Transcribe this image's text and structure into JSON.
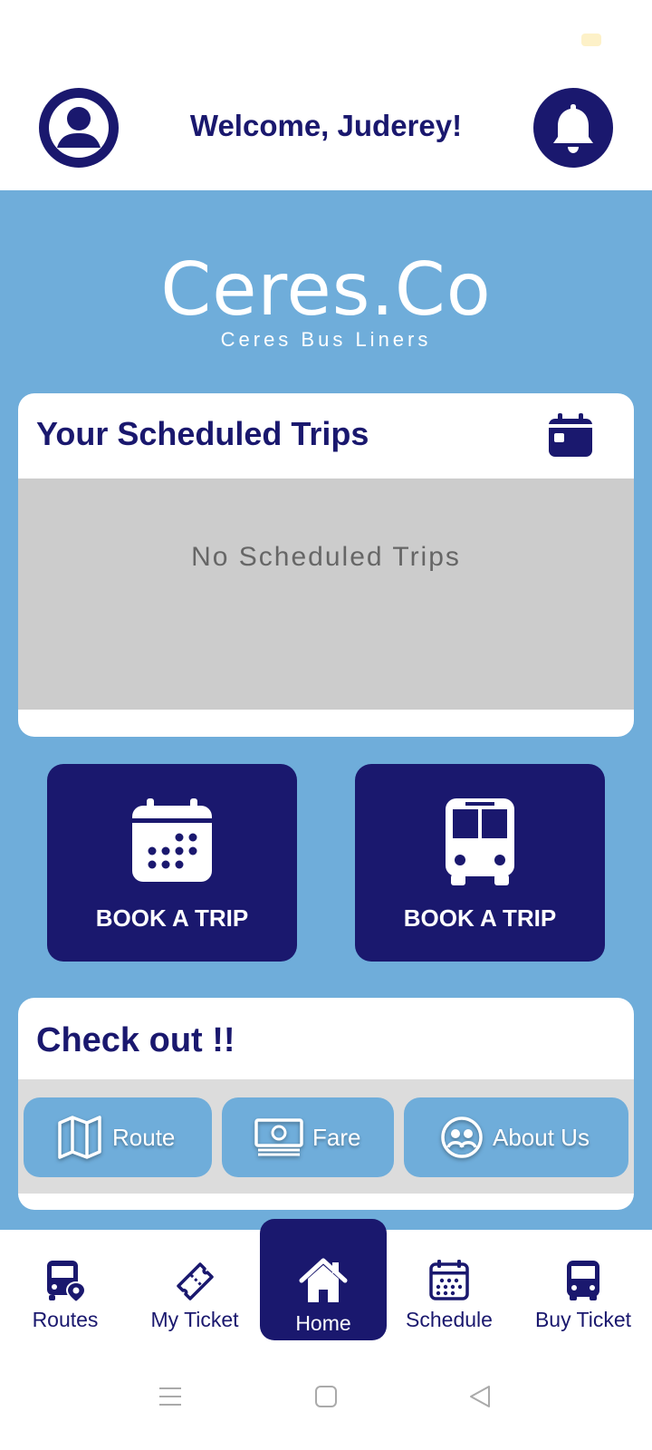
{
  "header": {
    "title": "Welcome, Juderey!"
  },
  "icons": {
    "profile": "user-circle-icon",
    "notifications": "bell-icon",
    "trips": "calendar-icon"
  },
  "brand": {
    "logo": "Ceres.Co",
    "tagline": "Ceres Bus Liners"
  },
  "trips": {
    "title": "Your Scheduled Trips",
    "empty_text": "No Scheduled Trips"
  },
  "actions": [
    {
      "label": "BOOK A TRIP",
      "icon": "calendar-dots-icon"
    },
    {
      "label": "BOOK A TRIP",
      "icon": "bus-icon"
    }
  ],
  "checkout": {
    "title": "Check out !!",
    "chips": [
      {
        "label": "Route",
        "icon": "map-icon"
      },
      {
        "label": "Fare",
        "icon": "money-icon"
      },
      {
        "label": "About Us",
        "icon": "users-icon"
      }
    ]
  },
  "nav": [
    {
      "label": "Routes",
      "icon": "bus-location-icon"
    },
    {
      "label": "My Ticket",
      "icon": "ticket-icon"
    },
    {
      "label": "Home",
      "icon": "home-icon",
      "active": true
    },
    {
      "label": "Schedule",
      "icon": "calendar-icon"
    },
    {
      "label": "Buy Ticket",
      "icon": "bus-icon"
    }
  ],
  "colors": {
    "primary": "#1a186e",
    "accent": "#6fadda",
    "empty_bg": "#cccccc"
  }
}
